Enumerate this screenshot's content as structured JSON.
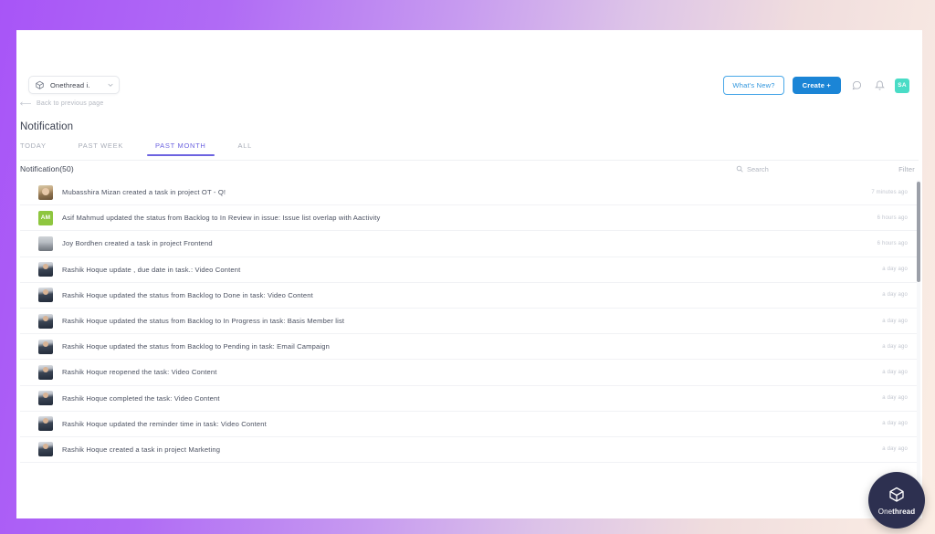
{
  "window": {
    "background_gradient_from": "#a855f7",
    "background_gradient_to": "#fbeee4"
  },
  "topbar": {
    "project_selector_label": "Onethread i.",
    "whats_new_label": "What's New?",
    "create_label": "Create +",
    "user_avatar_initials": "SA",
    "accent_blue": "#1b85d6",
    "avatar_color": "#49dcc6"
  },
  "breadcrumb": {
    "back_label": "Back to previous page"
  },
  "page": {
    "title": "Notification"
  },
  "tabs": [
    {
      "label": "TODAY",
      "active": false
    },
    {
      "label": "PAST WEEK",
      "active": false
    },
    {
      "label": "PAST MONTH",
      "active": true
    },
    {
      "label": "ALL",
      "active": false
    }
  ],
  "list_header": {
    "count_label": "Notification(50)",
    "search_placeholder": "Search",
    "filter_label": "Filter"
  },
  "notifications": [
    {
      "avatar_type": "photo-female",
      "avatar_initials": "",
      "text": "Mubasshira Mizan created a task in project OT - Q!",
      "time": "7 minutes ago"
    },
    {
      "avatar_type": "initials",
      "avatar_initials": "AM",
      "text": "Asif Mahmud updated the status from Backlog to In Review in issue: Issue list overlap with Aactivity",
      "time": "6 hours ago"
    },
    {
      "avatar_type": "photo-gray",
      "avatar_initials": "",
      "text": "Joy Bordhen created a task in project Frontend",
      "time": "6 hours ago"
    },
    {
      "avatar_type": "photo-male",
      "avatar_initials": "",
      "text": "Rashik Hoque update , due date in task.: Video Content",
      "time": "a day ago"
    },
    {
      "avatar_type": "photo-male",
      "avatar_initials": "",
      "text": "Rashik Hoque updated the status from Backlog to Done in task: Video Content",
      "time": "a day ago"
    },
    {
      "avatar_type": "photo-male",
      "avatar_initials": "",
      "text": "Rashik Hoque updated the status from Backlog to In Progress in task: Basis Member list",
      "time": "a day ago"
    },
    {
      "avatar_type": "photo-male",
      "avatar_initials": "",
      "text": "Rashik Hoque updated the status from Backlog to Pending in task: Email Campaign",
      "time": "a day ago"
    },
    {
      "avatar_type": "photo-male",
      "avatar_initials": "",
      "text": "Rashik Hoque reopened the task: Video Content",
      "time": "a day ago"
    },
    {
      "avatar_type": "photo-male",
      "avatar_initials": "",
      "text": "Rashik Hoque completed the task: Video Content",
      "time": "a day ago"
    },
    {
      "avatar_type": "photo-male",
      "avatar_initials": "",
      "text": "Rashik Hoque updated the reminder time in task: Video Content",
      "time": "a day ago"
    },
    {
      "avatar_type": "photo-male",
      "avatar_initials": "",
      "text": "Rashik Hoque created a task in project Marketing",
      "time": "a day ago"
    }
  ],
  "floating_badge": {
    "name_light": "One",
    "name_bold": "thread",
    "color": "#2d3050"
  }
}
